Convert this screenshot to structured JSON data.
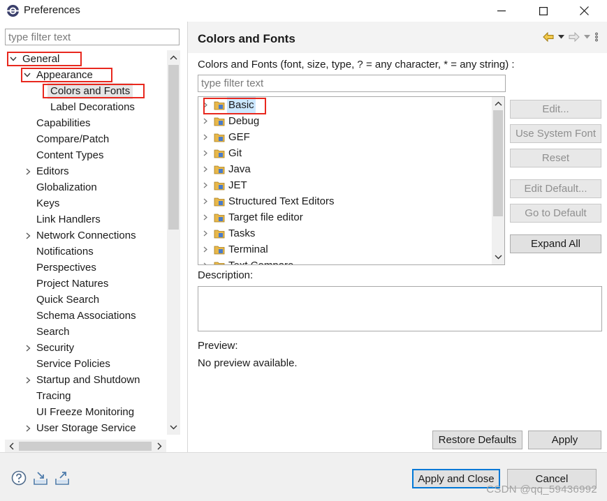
{
  "window": {
    "title": "Preferences",
    "controls": [
      "minimize",
      "maximize",
      "close"
    ]
  },
  "left": {
    "filter_placeholder": "type filter text",
    "tree": [
      {
        "label": "General",
        "expander": "expanded",
        "level": 0
      },
      {
        "label": "Appearance",
        "expander": "expanded",
        "level": 1
      },
      {
        "label": "Colors and Fonts",
        "expander": "none",
        "level": 2,
        "selected": true
      },
      {
        "label": "Label Decorations",
        "expander": "none",
        "level": 2
      },
      {
        "label": "Capabilities",
        "expander": "none",
        "level": 1
      },
      {
        "label": "Compare/Patch",
        "expander": "none",
        "level": 1
      },
      {
        "label": "Content Types",
        "expander": "none",
        "level": 1
      },
      {
        "label": "Editors",
        "expander": "collapsed",
        "level": 1
      },
      {
        "label": "Globalization",
        "expander": "none",
        "level": 1
      },
      {
        "label": "Keys",
        "expander": "none",
        "level": 1
      },
      {
        "label": "Link Handlers",
        "expander": "none",
        "level": 1
      },
      {
        "label": "Network Connections",
        "expander": "collapsed",
        "level": 1
      },
      {
        "label": "Notifications",
        "expander": "none",
        "level": 1
      },
      {
        "label": "Perspectives",
        "expander": "none",
        "level": 1
      },
      {
        "label": "Project Natures",
        "expander": "none",
        "level": 1
      },
      {
        "label": "Quick Search",
        "expander": "none",
        "level": 1
      },
      {
        "label": "Schema Associations",
        "expander": "none",
        "level": 1
      },
      {
        "label": "Search",
        "expander": "none",
        "level": 1
      },
      {
        "label": "Security",
        "expander": "collapsed",
        "level": 1
      },
      {
        "label": "Service Policies",
        "expander": "none",
        "level": 1
      },
      {
        "label": "Startup and Shutdown",
        "expander": "collapsed",
        "level": 1
      },
      {
        "label": "Tracing",
        "expander": "none",
        "level": 1
      },
      {
        "label": "UI Freeze Monitoring",
        "expander": "none",
        "level": 1
      },
      {
        "label": "User Storage Service",
        "expander": "collapsed",
        "level": 1
      }
    ]
  },
  "right": {
    "title": "Colors and Fonts",
    "subtitle": "Colors and Fonts (font, size, type, ? = any character, * = any string) :",
    "filter_placeholder": "type filter text",
    "categories": [
      "Basic",
      "Debug",
      "GEF",
      "Git",
      "Java",
      "JET",
      "Structured Text Editors",
      "Target file editor",
      "Tasks",
      "Terminal",
      "Text Compare"
    ],
    "selected_category": "Basic",
    "side_buttons": [
      {
        "label": "Edit...",
        "enabled": false
      },
      {
        "label": "Use System Font",
        "enabled": false
      },
      {
        "label": "Reset",
        "enabled": false
      },
      {
        "label": "Edit Default...",
        "enabled": false
      },
      {
        "label": "Go to Default",
        "enabled": false
      },
      {
        "label": "Expand All",
        "enabled": true
      }
    ],
    "description_label": "Description:",
    "preview_label": "Preview:",
    "preview_text": "No preview available.",
    "restore_defaults": "Restore Defaults",
    "apply": "Apply"
  },
  "footer": {
    "apply_and_close": "Apply and Close",
    "cancel": "Cancel",
    "icons": [
      "help-icon",
      "import-icon",
      "export-icon"
    ],
    "watermark": "CSDN @qq_59436992"
  },
  "colors": {
    "highlight_red": "#e8281e",
    "selection_blue": "#cce8ff",
    "default_button_border": "#0078d7",
    "folder_yellow": "#e8b84a"
  }
}
